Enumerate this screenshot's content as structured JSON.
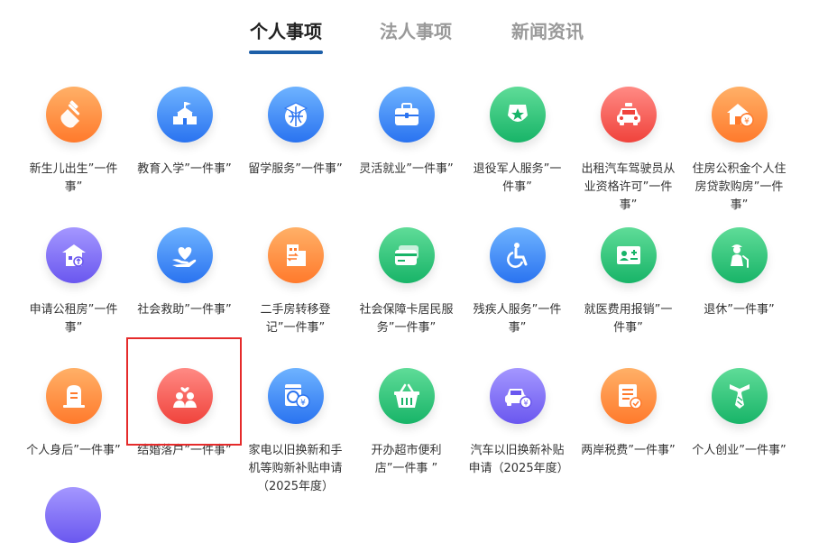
{
  "tabs": [
    {
      "label": "个人事项",
      "active": true
    },
    {
      "label": "法人事项",
      "active": false
    },
    {
      "label": "新闻资讯",
      "active": false
    }
  ],
  "services": [
    {
      "label": "新生儿出生”一件事”",
      "icon": "baby-bottle-icon",
      "color": "#ff7a2c"
    },
    {
      "label": "教育入学”一件事”",
      "icon": "school-icon",
      "color": "#2a73f0"
    },
    {
      "label": "留学服务”一件事”",
      "icon": "graduation-globe-icon",
      "color": "#2a73f0"
    },
    {
      "label": "灵活就业”一件事”",
      "icon": "briefcase-icon",
      "color": "#2a73f0"
    },
    {
      "label": "退役军人服务”一件事”",
      "icon": "military-badge-icon",
      "color": "#18b468"
    },
    {
      "label": "出租汽车驾驶员从业资格许可”一件事”",
      "icon": "taxi-icon",
      "color": "#f0433c"
    },
    {
      "label": "住房公积金个人住房贷款购房”一件事”",
      "icon": "house-yuan-icon",
      "color": "#ff7a2c"
    },
    {
      "label": "申请公租房”一件事”",
      "icon": "public-housing-icon",
      "color": "#6a57ef"
    },
    {
      "label": "社会救助”一件事”",
      "icon": "heart-hand-icon",
      "color": "#2a73f0"
    },
    {
      "label": "二手房转移登记”一件事”",
      "icon": "building-transfer-icon",
      "color": "#ff7a2c"
    },
    {
      "label": "社会保障卡居民服务”一件事”",
      "icon": "card-icon",
      "color": "#18b468"
    },
    {
      "label": "残疾人服务”一件事”",
      "icon": "wheelchair-icon",
      "color": "#2a73f0"
    },
    {
      "label": "就医费用报销”一件事”",
      "icon": "medical-card-icon",
      "color": "#18b468"
    },
    {
      "label": "退休”一件事”",
      "icon": "elderly-icon",
      "color": "#18b468"
    },
    {
      "label": "个人身后”一件事”",
      "icon": "memorial-icon",
      "color": "#ff7a2c"
    },
    {
      "label": "结婚落户”一件事”",
      "icon": "couple-icon",
      "color": "#f0433c",
      "selected": true
    },
    {
      "label": "家电以旧换新和手机等购新补贴申请（2025年度）",
      "icon": "appliance-subsidy-icon",
      "color": "#2a73f0"
    },
    {
      "label": "开办超市便利店”一件事 ”",
      "icon": "shopping-basket-icon",
      "color": "#18b468"
    },
    {
      "label": "汽车以旧换新补贴申请（2025年度）",
      "icon": "car-subsidy-icon",
      "color": "#6a57ef"
    },
    {
      "label": "两岸税费”一件事”",
      "icon": "tax-document-icon",
      "color": "#ff7a2c"
    },
    {
      "label": "个人创业”一件事”",
      "icon": "tie-icon",
      "color": "#18b468"
    }
  ]
}
